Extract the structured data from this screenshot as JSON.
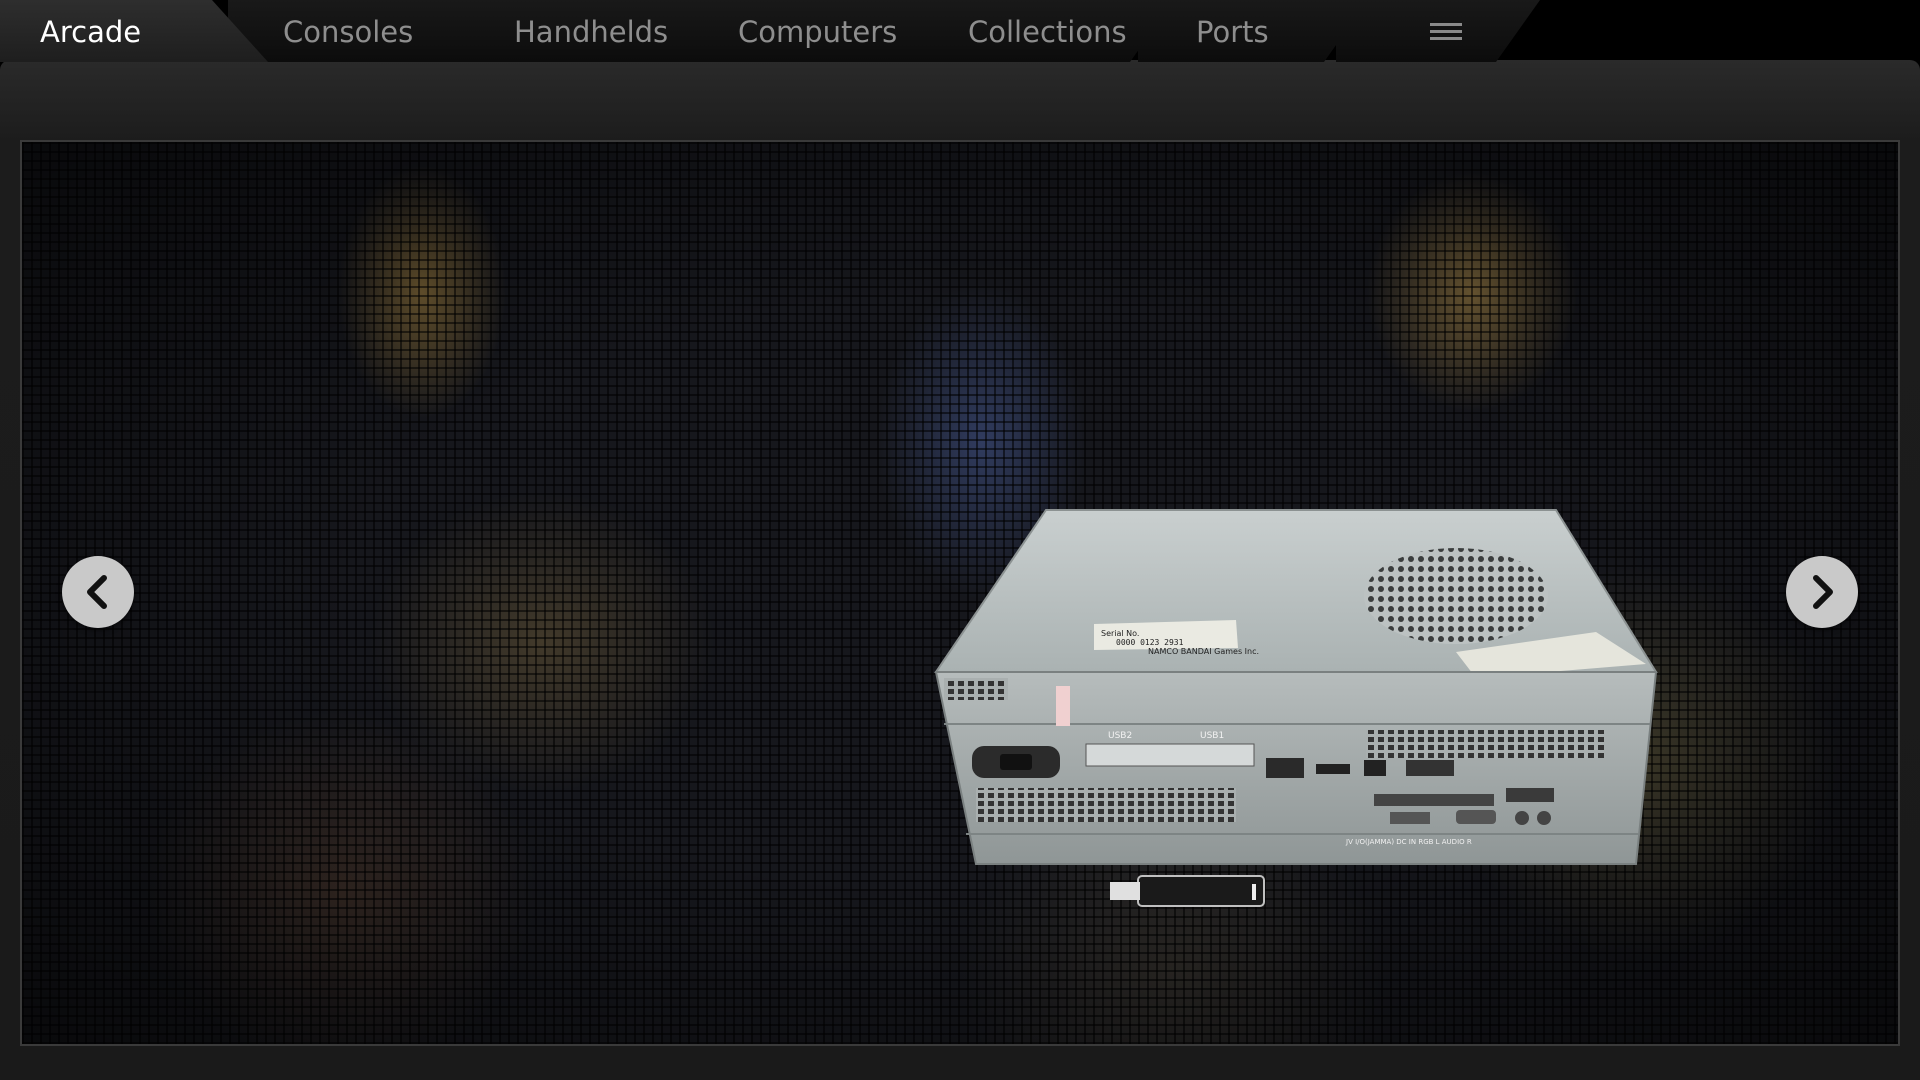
{
  "tabs": [
    {
      "label": "Arcade",
      "active": true
    },
    {
      "label": "Consoles",
      "active": false
    },
    {
      "label": "Handhelds",
      "active": false
    },
    {
      "label": "Computers",
      "active": false
    },
    {
      "label": "Collections",
      "active": false
    },
    {
      "label": "Ports",
      "active": false
    }
  ],
  "menu": {
    "icon": "hamburger-menu-icon"
  },
  "carousel": {
    "prev_icon": "chevron-left-icon",
    "next_icon": "chevron-right-icon",
    "device": {
      "icon": "arcade-board-hardware-image",
      "serial_label": "Serial No.",
      "serial_value": "0000 0123 2931",
      "maker_label": "NAMCO BANDAI Games Inc.",
      "port_usb2": "USB2",
      "port_usb1": "USB1",
      "port_row": "JV I/O(JAMMA) DC IN   RGB   L AUDIO R"
    }
  },
  "colors": {
    "active_tab_text": "#ffffff",
    "inactive_tab_text": "#8e8e8e",
    "panel": "#1c1c1c",
    "nav_button": "#c9c9c9"
  }
}
